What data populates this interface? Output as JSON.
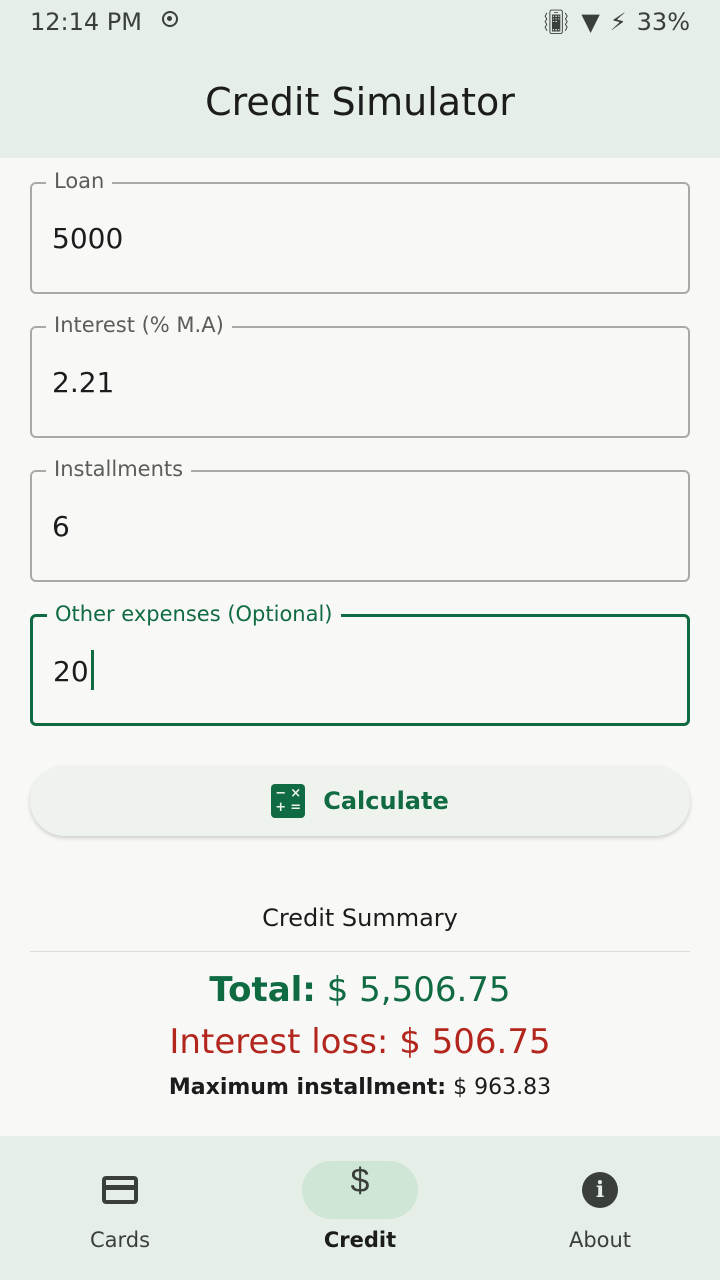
{
  "status_bar": {
    "time": "12:14 PM",
    "battery": "33%"
  },
  "app_bar": {
    "title": "Credit Simulator"
  },
  "form": {
    "loan": {
      "label": "Loan",
      "value": "5000"
    },
    "interest": {
      "label": "Interest (% M.A)",
      "value": "2.21"
    },
    "installments": {
      "label": "Installments",
      "value": "6"
    },
    "other_expenses": {
      "label": "Other expenses (Optional)",
      "value": "20"
    }
  },
  "calculate_button": {
    "label": "Calculate"
  },
  "summary": {
    "title": "Credit Summary",
    "total_label": "Total:",
    "total_value": "$ 5,506.75",
    "interest_loss_label": "Interest loss:",
    "interest_loss_value": "$ 506.75",
    "max_installment_label": "Maximum installment:",
    "max_installment_value": "$ 963.83"
  },
  "bottom_nav": {
    "items": [
      {
        "label": "Cards",
        "icon": "credit-card-icon"
      },
      {
        "label": "Credit",
        "icon": "dollar-icon"
      },
      {
        "label": "About",
        "icon": "info-icon"
      }
    ],
    "active": "Credit"
  },
  "colors": {
    "primary": "#106a42",
    "error": "#b3261e",
    "surface": "#e6efe7"
  }
}
